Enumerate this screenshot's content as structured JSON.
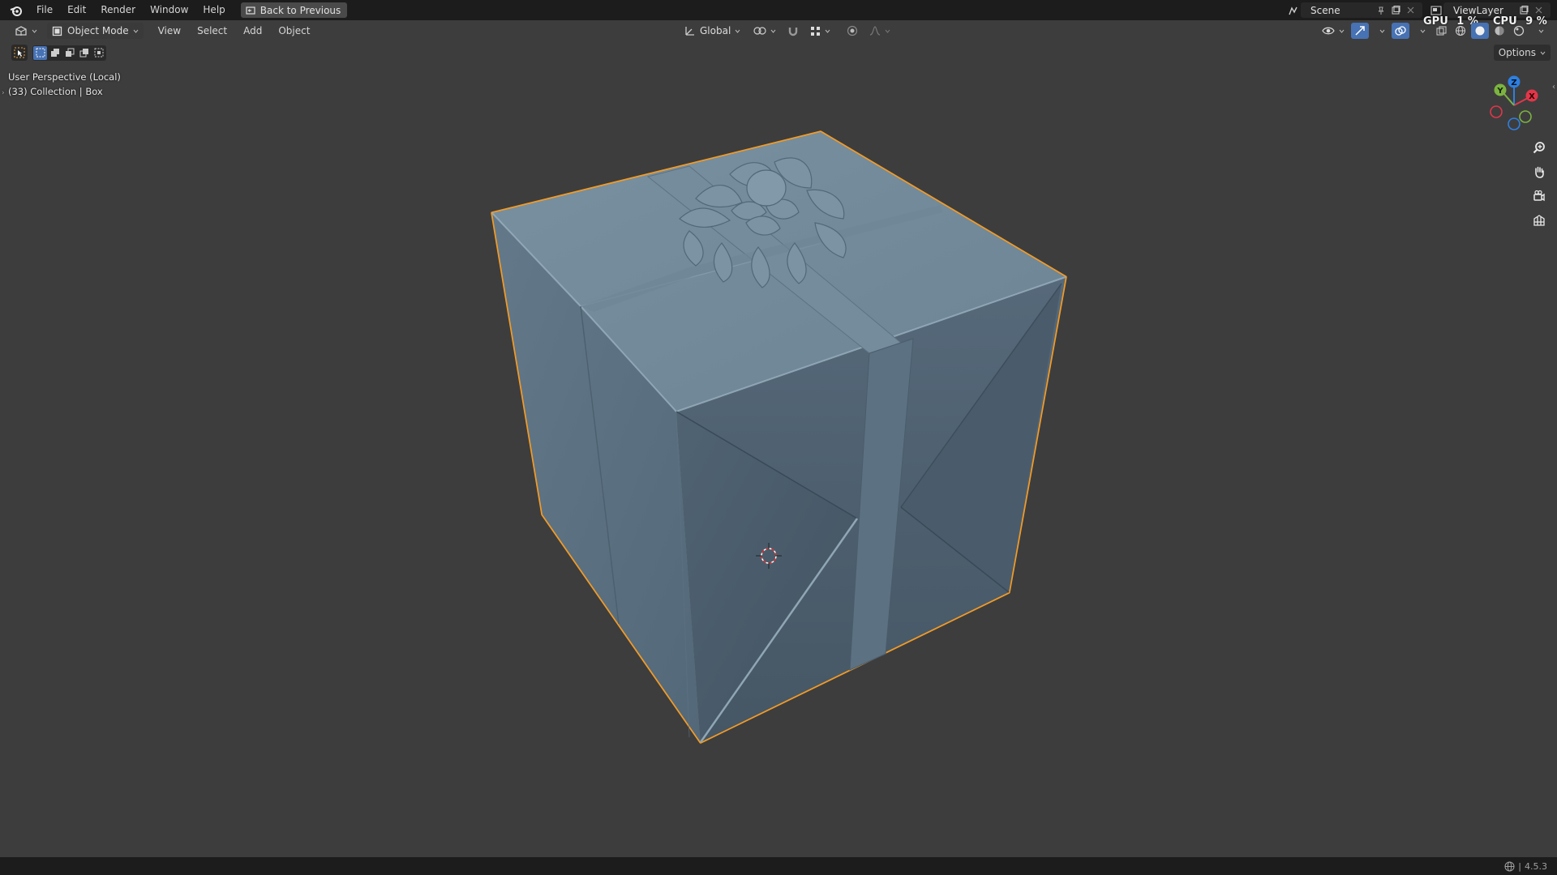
{
  "topbar": {
    "menus": [
      "File",
      "Edit",
      "Render",
      "Window",
      "Help"
    ],
    "back_button": "Back to Previous",
    "scene": "Scene",
    "view_layer": "ViewLayer",
    "gpu_label": "GPU",
    "gpu_value": "1 %",
    "cpu_label": "CPU",
    "cpu_value": "9 %"
  },
  "header": {
    "mode": "Object Mode",
    "menus": [
      "View",
      "Select",
      "Add",
      "Object"
    ],
    "transform_orientation": "Global"
  },
  "viewport": {
    "perspective_label": "User Perspective (Local)",
    "collection_label": "(33) Collection | Box",
    "options_label": "Options",
    "object_color": "#6e8797",
    "outline_color": "#f29b27",
    "background_color": "#3d3d3d"
  },
  "gizmo": {
    "x_label": "X",
    "y_label": "Y",
    "z_label": "Z",
    "x_color": "#e0374a",
    "y_color": "#7cb342",
    "z_color": "#2f7fe0"
  },
  "statusbar": {
    "version": "4.5.3"
  }
}
